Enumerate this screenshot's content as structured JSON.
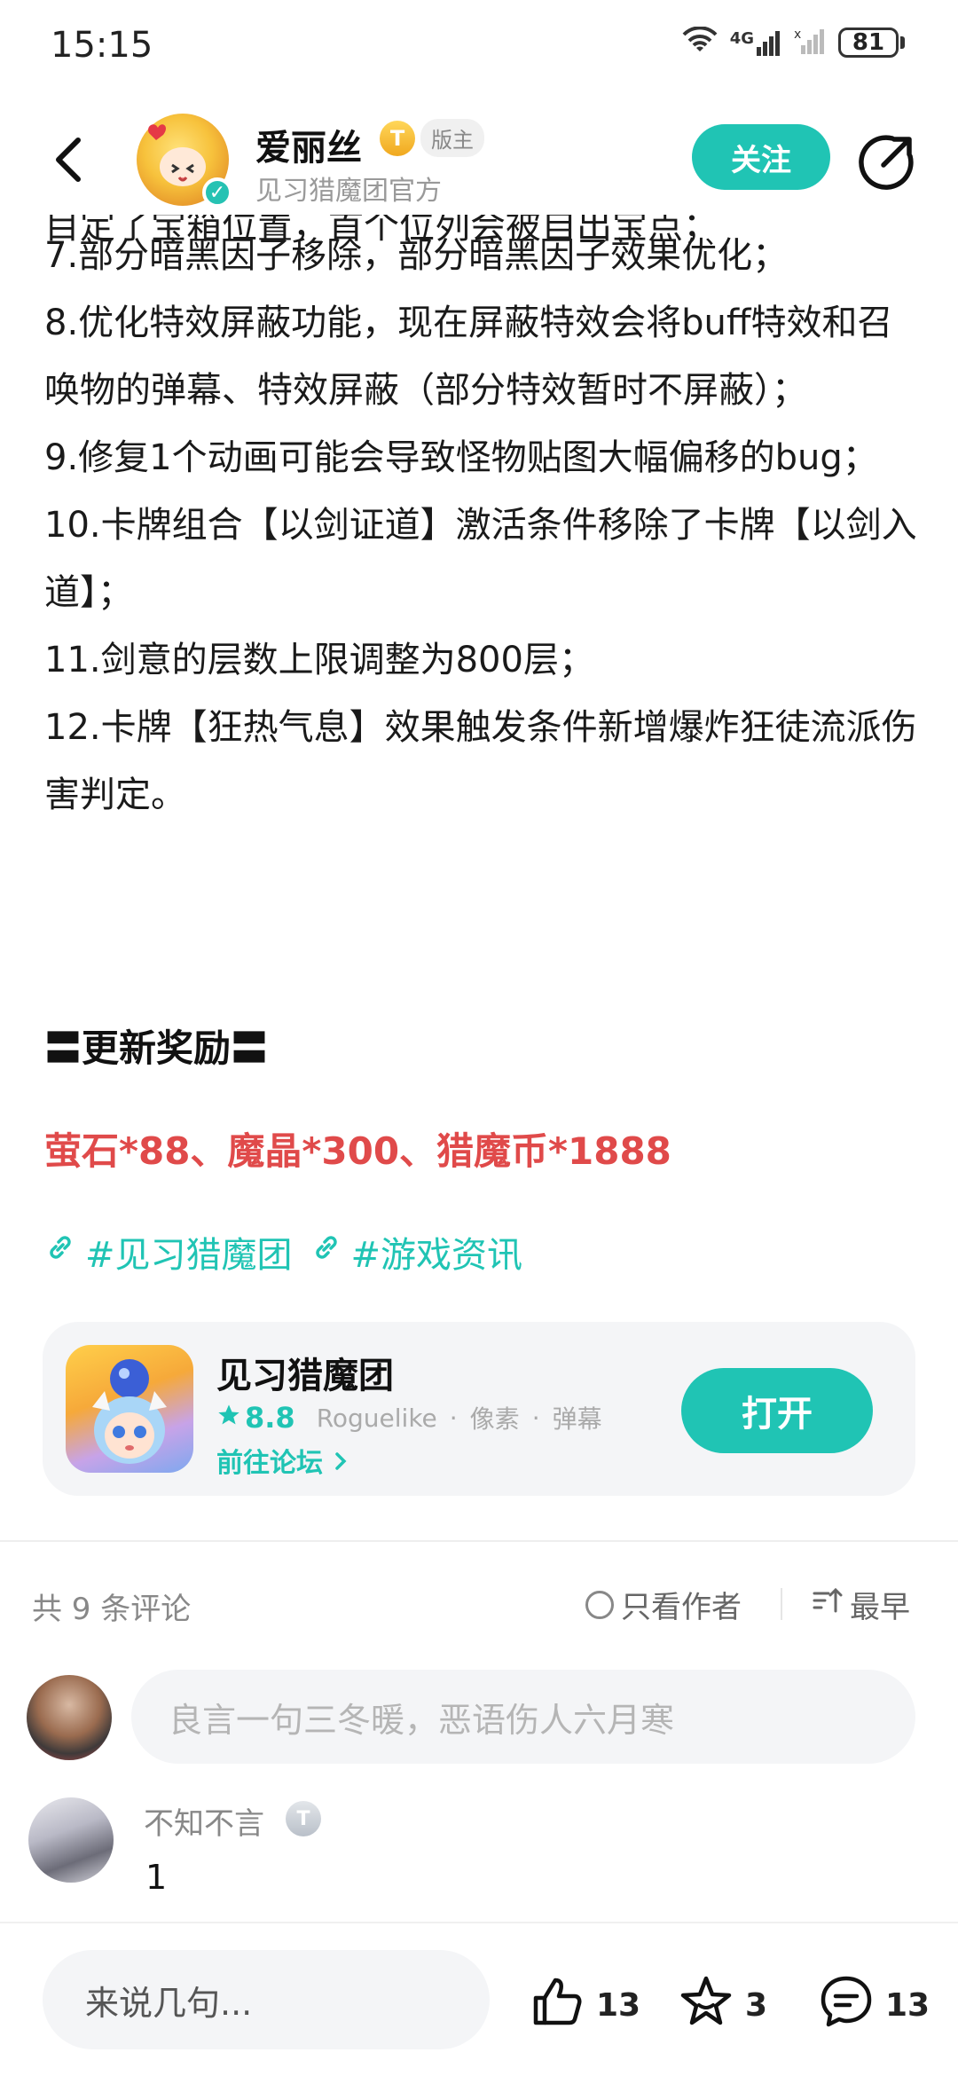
{
  "status_bar": {
    "time": "15:15",
    "network": "4G",
    "battery": "81"
  },
  "header": {
    "author_name": "爱丽丝",
    "level_badge": "T",
    "mod_badge": "版主",
    "author_subtitle": "见习猎魔团官方",
    "follow_label": "关注"
  },
  "article": {
    "cut_line": "目定了宝箱位置，首个位列会被自出宝点；",
    "items": [
      "7.部分暗黑因子移除，部分暗黑因子效果优化；",
      "8.优化特效屏蔽功能，现在屏蔽特效会将buff特效和召唤物的弹幕、特效屏蔽（部分特效暂时不屏蔽）；",
      "9.修复1个动画可能会导致怪物贴图大幅偏移的bug；",
      "10.卡牌组合【以剑证道】激活条件移除了卡牌【以剑入道】；",
      "11.剑意的层数上限调整为800层；",
      "12.卡牌【狂热气息】效果触发条件新增爆炸狂徒流派伤害判定。"
    ],
    "section_title": "〓更新奖励〓",
    "reward": "萤石*88、魔晶*300、猎魔币*1888",
    "tags": [
      "#见习猎魔团",
      "#游戏资讯"
    ]
  },
  "game_card": {
    "name": "见习猎魔团",
    "rating": "8.8",
    "genres": [
      "Roguelike",
      "像素",
      "弹幕"
    ],
    "forum_link": "前往论坛",
    "open_label": "打开"
  },
  "comments": {
    "count_label": "共 9 条评论",
    "author_only_label": "只看作者",
    "sort_label": "最早",
    "input_placeholder": "良言一句三冬暖，恶语伤人六月寒",
    "items": [
      {
        "user": "不知不言",
        "badge": "T",
        "text": "1"
      }
    ]
  },
  "bottom_bar": {
    "reply_placeholder": "来说几句...",
    "likes": "13",
    "favorites": "3",
    "comments": "13"
  },
  "colors": {
    "accent": "#20c4b4",
    "reward_red": "#e04a4a"
  }
}
